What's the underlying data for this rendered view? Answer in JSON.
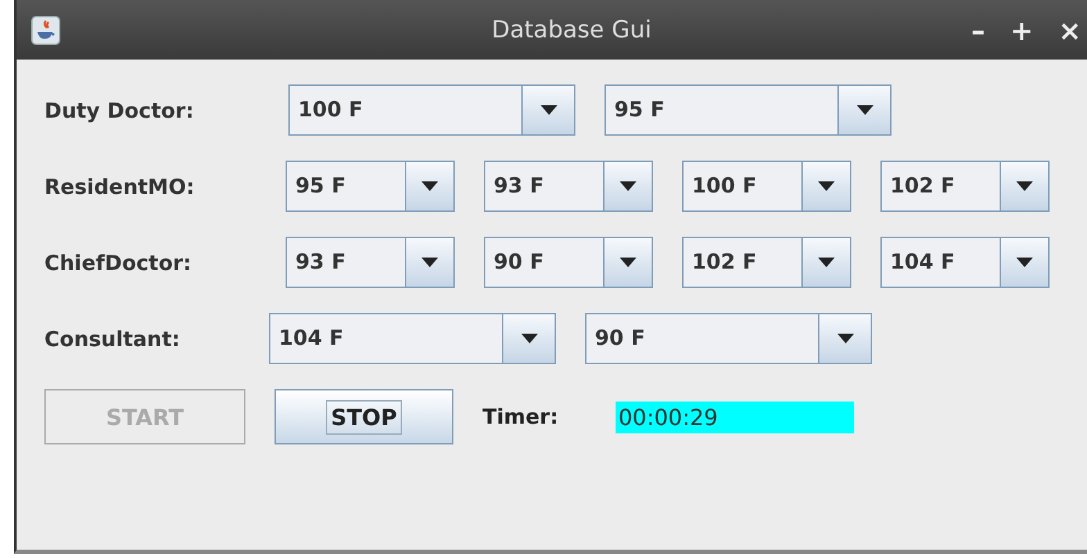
{
  "window": {
    "title": "Database Gui",
    "controls": [
      "–",
      "+",
      "×"
    ]
  },
  "rows": [
    {
      "label": "Duty Doctor:",
      "combos": [
        "100 F",
        "95 F"
      ]
    },
    {
      "label": "ResidentMO:",
      "combos": [
        "95 F",
        "93 F",
        "100 F",
        "102 F"
      ]
    },
    {
      "label": "ChiefDoctor:",
      "combos": [
        "93 F",
        "90 F",
        "102 F",
        "104 F"
      ]
    },
    {
      "label": "Consultant:",
      "combos": [
        "104 F",
        "90 F"
      ]
    }
  ],
  "buttons": [
    {
      "label": "START",
      "disabled": true,
      "focused": false
    },
    {
      "label": "STOP",
      "disabled": false,
      "focused": true
    }
  ],
  "timer": {
    "label": "Timer:",
    "value": "00:00:29"
  }
}
